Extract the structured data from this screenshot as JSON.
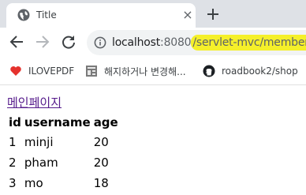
{
  "browser": {
    "tab": {
      "title": "Title"
    },
    "new_tab_label": "+",
    "close_label": "×",
    "address": {
      "host": "localhost",
      "port": ":8080",
      "path": "/servlet-mvc/members",
      "highlight_color": "#f5f02a"
    },
    "bookmarks": [
      {
        "label": "ILOVEPDF",
        "icon": "heart-icon"
      },
      {
        "label": "해지하거나 변경해...",
        "icon": "document-icon"
      },
      {
        "label": "roadbook2/shop",
        "icon": "github-icon"
      }
    ]
  },
  "page": {
    "home_link": "메인페이지",
    "table": {
      "headers": [
        "id",
        "username",
        "age"
      ],
      "rows": [
        [
          "1",
          "minji",
          "20"
        ],
        [
          "2",
          "pham",
          "20"
        ],
        [
          "3",
          "mo",
          "18"
        ]
      ]
    }
  }
}
